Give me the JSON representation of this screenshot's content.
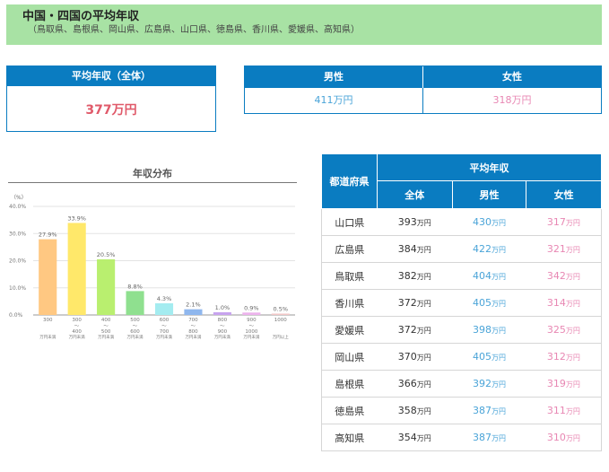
{
  "header": {
    "title": "中国・四国の平均年収",
    "subtitle": "（鳥取県、島根県、岡山県、広島県、山口県、徳島県、香川県、愛媛県、高知県）"
  },
  "overall": {
    "label": "平均年収（全体）",
    "value": "377万円"
  },
  "gender": {
    "male_label": "男性",
    "female_label": "女性",
    "male_value": "411万円",
    "female_value": "318万円"
  },
  "chart_data": {
    "type": "bar",
    "title": "年収分布",
    "ylabel": "（%）",
    "ylim": [
      0,
      40
    ],
    "yticks": [
      "0.0%",
      "10.0%",
      "20.0%",
      "30.0%",
      "40.0%"
    ],
    "categories": [
      "300万円未満",
      "300〜400万円未満",
      "400〜500万円未満",
      "500〜600万円未満",
      "600〜700万円未満",
      "700〜800万円未満",
      "800〜900万円未満",
      "900〜1000万円未満",
      "1000万円以上"
    ],
    "category_top_labels": [
      "300",
      "300",
      "400",
      "500",
      "600",
      "700",
      "800",
      "900",
      "1000"
    ],
    "category_mid_labels": [
      "",
      "〜",
      "〜",
      "〜",
      "〜",
      "〜",
      "〜",
      "〜",
      ""
    ],
    "category_low_labels": [
      "",
      "400",
      "500",
      "600",
      "700",
      "800",
      "900",
      "1000",
      ""
    ],
    "category_tail_labels": [
      "万円未満",
      "万円未満",
      "万円未満",
      "万円未満",
      "万円未満",
      "万円未満",
      "万円未満",
      "万円未満",
      "万円以上"
    ],
    "values": [
      27.9,
      33.9,
      20.5,
      8.8,
      4.3,
      2.1,
      1.0,
      0.9,
      0.5
    ],
    "value_labels": [
      "27.9%",
      "33.9%",
      "20.5%",
      "8.8%",
      "4.3%",
      "2.1%",
      "1.0%",
      "0.9%",
      "0.5%"
    ],
    "colors": [
      "#ffc882",
      "#ffe86a",
      "#b9ef6f",
      "#8fe08f",
      "#a4ecf0",
      "#8fb7ee",
      "#c7a3ee",
      "#ecb3ec",
      "#f2c6c6"
    ]
  },
  "table": {
    "col_pref": "都道府県",
    "col_group": "平均年収",
    "col_all": "全体",
    "col_male": "男性",
    "col_female": "女性",
    "unit": "万円",
    "rows": [
      {
        "pref": "山口県",
        "all": "393",
        "male": "430",
        "female": "317"
      },
      {
        "pref": "広島県",
        "all": "384",
        "male": "422",
        "female": "321"
      },
      {
        "pref": "鳥取県",
        "all": "382",
        "male": "404",
        "female": "342"
      },
      {
        "pref": "香川県",
        "all": "372",
        "male": "405",
        "female": "314"
      },
      {
        "pref": "愛媛県",
        "all": "372",
        "male": "398",
        "female": "325"
      },
      {
        "pref": "岡山県",
        "all": "370",
        "male": "405",
        "female": "312"
      },
      {
        "pref": "島根県",
        "all": "366",
        "male": "392",
        "female": "319"
      },
      {
        "pref": "徳島県",
        "all": "358",
        "male": "387",
        "female": "311"
      },
      {
        "pref": "高知県",
        "all": "354",
        "male": "387",
        "female": "310"
      }
    ]
  }
}
